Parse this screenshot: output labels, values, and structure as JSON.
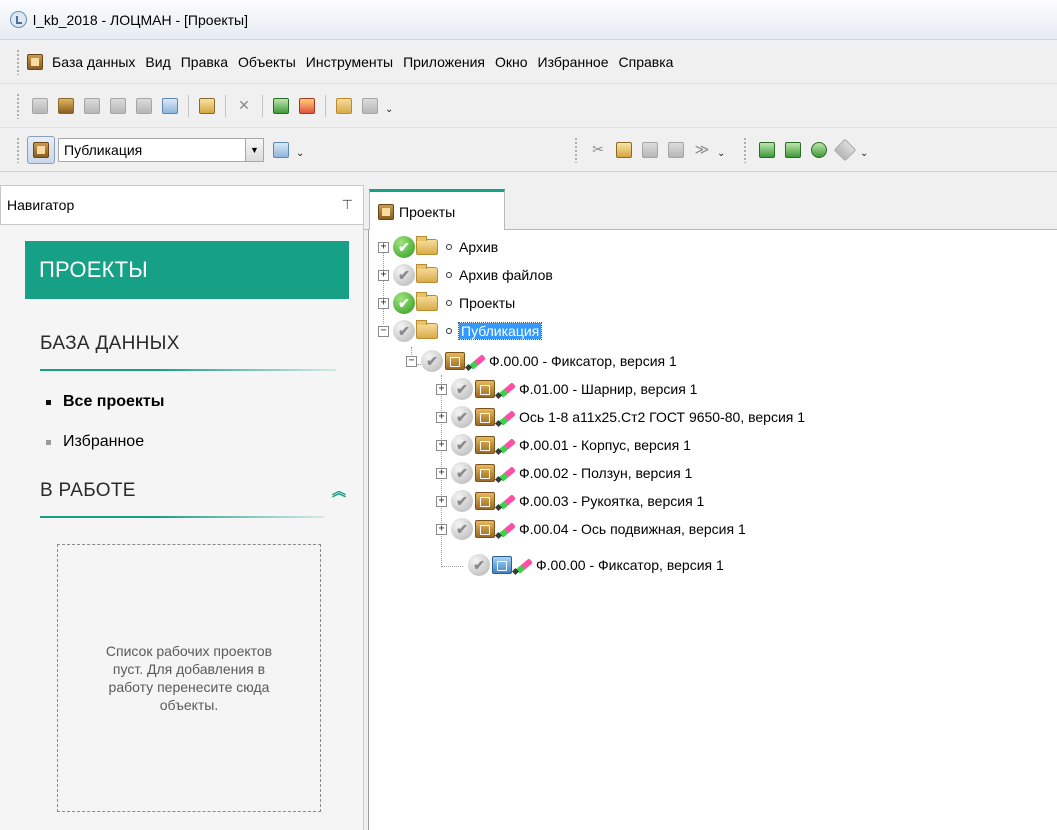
{
  "window": {
    "title": "l_kb_2018 - ЛОЦМАН - [Проекты]"
  },
  "menu": {
    "items": [
      "База данных",
      "Вид",
      "Правка",
      "Объекты",
      "Инструменты",
      "Приложения",
      "Окно",
      "Избранное",
      "Справка"
    ]
  },
  "toolbar": {
    "icons": [
      "copy-icon",
      "new-object-icon",
      "paste-icon",
      "duplicate-icon",
      "move-icon",
      "add-window-icon",
      "task-icon",
      "delete-icon",
      "image-icon",
      "report-icon",
      "folder-icon",
      "forward-icon"
    ],
    "more_glyph": "⌄"
  },
  "view_selector": {
    "value": "Публикация",
    "arrow": "▼"
  },
  "navigator": {
    "title": "Навигатор",
    "pin_glyph": "⊤",
    "banner": "ПРОЕКТЫ",
    "database_heading": "БАЗА ДАННЫХ",
    "links": [
      {
        "label": "Все проекты",
        "active": true
      },
      {
        "label": "Избранное",
        "active": false
      }
    ],
    "in_work_heading": "В РАБОТЕ",
    "collapse_glyph": "︽",
    "empty_text": "Список рабочих проектов пуст. Для добавления в работу перенесите сюда объекты."
  },
  "tab": {
    "label": "Проекты"
  },
  "tree": {
    "roots": [
      {
        "label": "Архив",
        "status": "green"
      },
      {
        "label": "Архив файлов",
        "status": "grey"
      },
      {
        "label": "Проекты",
        "status": "green"
      },
      {
        "label": "Публикация",
        "status": "grey",
        "selected": true
      }
    ],
    "publication_child": "Ф.00.00 - Фиксатор, версия 1",
    "subitems": [
      "Ф.01.00 - Шарнир, версия 1",
      "Ось 1-8 а11х25.Ст2 ГОСТ 9650-80, версия 1",
      "Ф.00.01 - Корпус, версия 1",
      "Ф.00.02 - Ползун, версия 1",
      "Ф.00.03 - Рукоятка, версия 1",
      "Ф.00.04 - Ось подвижная, версия 1",
      "Ф.00.00 - Фиксатор, версия 1"
    ],
    "expand_glyph": "+",
    "collapse_glyph": "−",
    "check_glyph": "✔"
  },
  "colors": {
    "accent": "#16a085",
    "selection": "#3399ff"
  }
}
